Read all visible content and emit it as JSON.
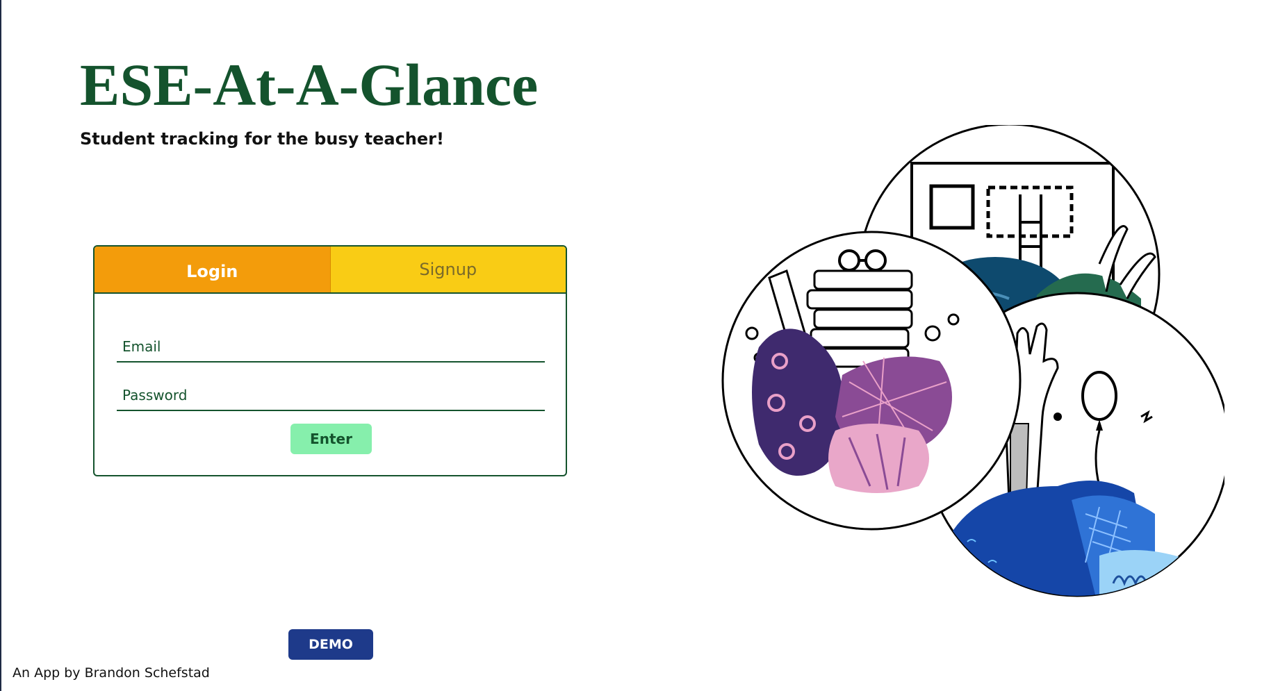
{
  "header": {
    "title": "ESE-At-A-Glance",
    "tagline": "Student tracking for the busy teacher!"
  },
  "auth": {
    "tabs": [
      {
        "label": "Login",
        "active": true
      },
      {
        "label": "Signup",
        "active": false
      }
    ],
    "email_placeholder": "Email",
    "password_placeholder": "Password",
    "enter_label": "Enter"
  },
  "demo_label": "DEMO",
  "footer": {
    "credit": "An App by Brandon Schefstad"
  },
  "illustration": {
    "icons": [
      "classroom-window-icon",
      "books-glasses-icon",
      "raised-hand-balloon-icon"
    ]
  },
  "colors": {
    "title": "#14532d",
    "login_tab": "#f39c0b",
    "signup_tab": "#f9cc15",
    "enter_button": "#86efac",
    "demo_button": "#1e3a8a"
  }
}
